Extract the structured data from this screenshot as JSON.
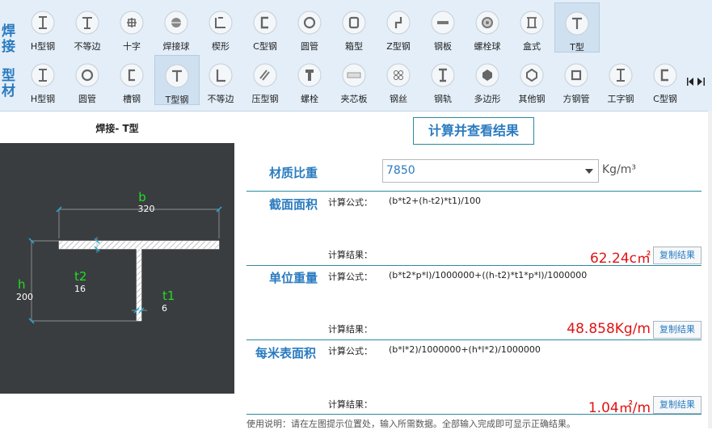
{
  "toolbar": {
    "row1_label": "焊接",
    "row2_label": "型材",
    "row1_items": [
      {
        "label": "H型钢",
        "icon": "h-beam-icon"
      },
      {
        "label": "不等边",
        "icon": "unequal-icon"
      },
      {
        "label": "十字",
        "icon": "cross-icon"
      },
      {
        "label": "焊接球",
        "icon": "weld-ball-icon"
      },
      {
        "label": "楔形",
        "icon": "wedge-icon"
      },
      {
        "label": "C型钢",
        "icon": "c-channel-icon"
      },
      {
        "label": "圆管",
        "icon": "round-tube-icon"
      },
      {
        "label": "箱型",
        "icon": "box-icon"
      },
      {
        "label": "Z型钢",
        "icon": "z-steel-icon"
      },
      {
        "label": "钢板",
        "icon": "plate-icon"
      },
      {
        "label": "螺栓球",
        "icon": "bolt-ball-icon"
      },
      {
        "label": "盒式",
        "icon": "box-type-icon"
      },
      {
        "label": "T型",
        "icon": "t-steel-icon"
      }
    ],
    "row2_items": [
      {
        "label": "H型钢",
        "icon": "h-beam-icon"
      },
      {
        "label": "圆管",
        "icon": "round-tube-icon"
      },
      {
        "label": "槽钢",
        "icon": "channel-icon"
      },
      {
        "label": "T型钢",
        "icon": "t-steel-icon"
      },
      {
        "label": "不等边",
        "icon": "angle-icon"
      },
      {
        "label": "压型钢",
        "icon": "profiled-steel-icon"
      },
      {
        "label": "螺栓",
        "icon": "bolt-icon"
      },
      {
        "label": "夹芯板",
        "icon": "sandwich-panel-icon"
      },
      {
        "label": "钢丝",
        "icon": "steel-wire-icon"
      },
      {
        "label": "钢轨",
        "icon": "rail-icon"
      },
      {
        "label": "多边形",
        "icon": "polygon-icon"
      },
      {
        "label": "其他钢",
        "icon": "other-steel-icon"
      },
      {
        "label": "方钢管",
        "icon": "square-tube-icon"
      },
      {
        "label": "工字钢",
        "icon": "i-beam-icon"
      },
      {
        "label": "C型钢",
        "icon": "c-channel-icon"
      }
    ],
    "selected_row1": "T型",
    "selected_row2": "T型钢"
  },
  "drawing": {
    "title": "焊接- T型",
    "b_label": "b",
    "b_value": "320",
    "h_label": "h",
    "h_value": "200",
    "t2_label": "t2",
    "t2_value": "16",
    "t1_label": "t1",
    "t1_value": "6"
  },
  "calc_button": "计算并查看结果",
  "density": {
    "label": "材质比重",
    "value": "7850",
    "unit": "Kg/m³"
  },
  "sections": [
    {
      "label": "截面面积",
      "formula_label": "计算公式：",
      "formula": "(b*t2+(h-t2)*t1)/100",
      "result_label": "计算结果：",
      "result": "62.24c㎡",
      "copy": "复制结果"
    },
    {
      "label": "单位重量",
      "formula_label": "计算公式：",
      "formula": "(b*t2*p*l)/1000000+((h-t2)*t1*p*l)/1000000",
      "result_label": "计算结果：",
      "result": "48.858Kg/m",
      "copy": "复制结果"
    },
    {
      "label": "每米表面积",
      "formula_label": "计算公式：",
      "formula": "(b*l*2)/1000000+(h*l*2)/1000000",
      "result_label": "计算结果：",
      "result": "1.04㎡/m",
      "copy": "复制结果"
    }
  ],
  "footer": "使用说明：请在左图提示位置处，输入所需数据。全部输入完成即可显示正确结果。",
  "colors": {
    "accent": "#2a7bc0",
    "result": "#e01414",
    "canvas": "#3a3d40",
    "dimension": "#22dd22",
    "toolbar": "#e3eef8"
  }
}
